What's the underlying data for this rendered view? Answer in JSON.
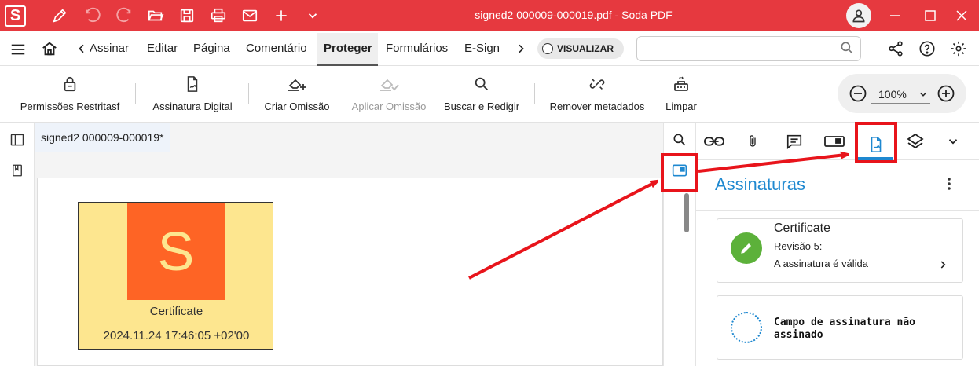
{
  "window": {
    "logo_letter": "S",
    "title": "signed2 000009-000019.pdf   -   Soda PDF"
  },
  "quick_access": [
    "pen-icon",
    "undo-icon",
    "redo-icon",
    "folder-open-icon",
    "save-icon",
    "print-icon",
    "mail-icon",
    "plus-icon",
    "chevron-down-icon"
  ],
  "menubar": {
    "tabs": [
      {
        "label": "Assinar"
      },
      {
        "label": "Editar"
      },
      {
        "label": "Página"
      },
      {
        "label": "Comentário"
      },
      {
        "label": "Proteger",
        "active": true
      },
      {
        "label": "Formulários"
      },
      {
        "label": "E-Sign"
      }
    ],
    "view_toggle_label": "VISUALIZAR",
    "search_placeholder": ""
  },
  "toolbar": {
    "tools": [
      {
        "label": "Permissões Restritasf",
        "icon": "lock-icon"
      },
      {
        "label": "Assinatura Digital",
        "icon": "signature-doc-icon"
      },
      {
        "label": "Criar Omissão",
        "icon": "eraser-plus-icon"
      },
      {
        "label": "Aplicar Omissão",
        "icon": "eraser-check-icon",
        "disabled": true
      },
      {
        "label": "Buscar e Redigir",
        "icon": "search-icon"
      },
      {
        "label": "Remover metadados",
        "icon": "link-broken-icon"
      },
      {
        "label": "Limpar",
        "icon": "clean-icon"
      }
    ],
    "zoom": "100%"
  },
  "document": {
    "tab_title": "signed2 000009-000019*",
    "signature_stamp": {
      "logo_letter": "S",
      "name": "Certificate",
      "date": "2024.11.24 17:46:05 +02'00"
    }
  },
  "right_panel": {
    "title": "Assinaturas",
    "signatures": [
      {
        "name": "Certificate",
        "revision": "Revisão 5:",
        "status": "A assinatura é válida"
      }
    ],
    "unsigned_field": "Campo de assinatura não assinado"
  },
  "colors": {
    "titlebar": "#e6393f",
    "accent_blue": "#1e88d0",
    "valid_green": "#5cb13a",
    "annotation_red": "#e8141b",
    "stamp_bg": "#fde68f",
    "stamp_logo": "#fe6425"
  }
}
